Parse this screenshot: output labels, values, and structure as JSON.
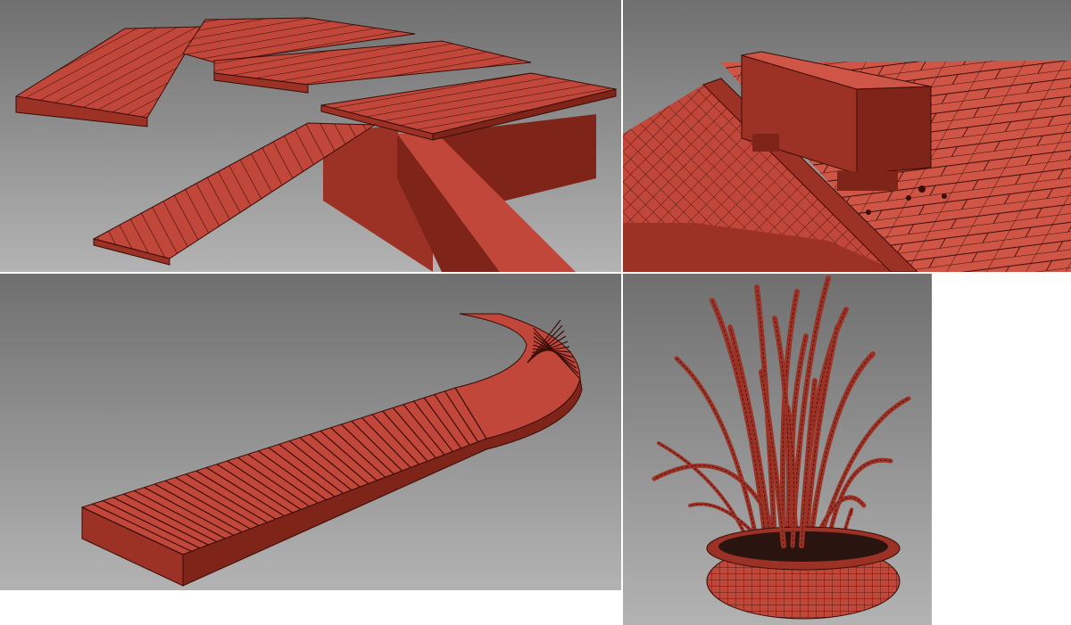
{
  "colors": {
    "background_top": "#6f6f6f",
    "background_bottom": "#b3b3b3",
    "model_face": "#c0473a",
    "model_face_light": "#cf5646",
    "model_side": "#9c3225",
    "model_side_dark": "#7e2418",
    "wire": "#3a0c07",
    "frame": "#ffffff"
  },
  "viewports": [
    {
      "id": "top-left",
      "subject": "deck-with-ramp-render"
    },
    {
      "id": "top-right",
      "subject": "bench-on-paving-render"
    },
    {
      "id": "bottom-left",
      "subject": "curved-boardwalk-render"
    },
    {
      "id": "bottom-right",
      "subject": "potted-grass-render"
    }
  ]
}
